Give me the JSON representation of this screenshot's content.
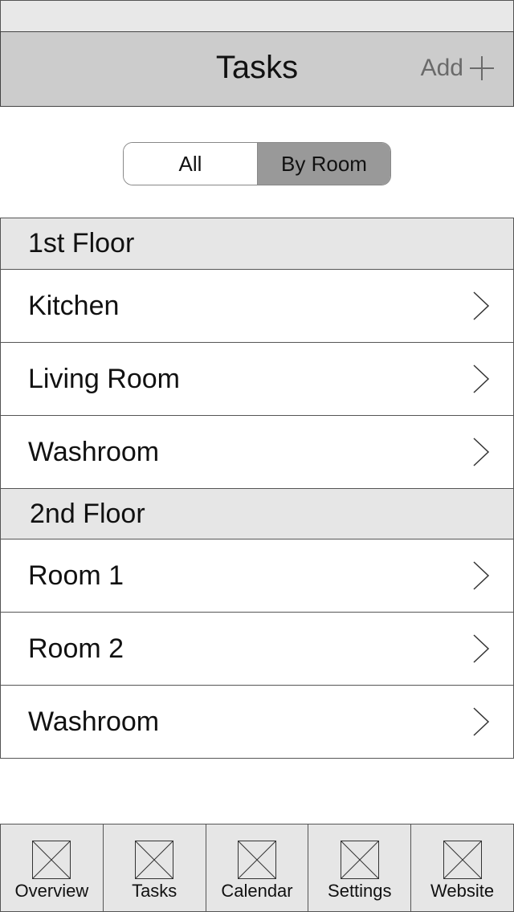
{
  "header": {
    "title": "Tasks",
    "add_label": "Add"
  },
  "segmented": {
    "options": [
      "All",
      "By Room"
    ],
    "selected": "By Room"
  },
  "sections": [
    {
      "title": "1st Floor",
      "rows": [
        "Kitchen",
        "Living Room",
        "Washroom"
      ]
    },
    {
      "title": "2nd Floor",
      "rows": [
        "Room 1",
        "Room 2",
        "Washroom"
      ]
    }
  ],
  "tab_bar": {
    "tabs": [
      {
        "label": "Overview",
        "icon": "placeholder-image-icon"
      },
      {
        "label": "Tasks",
        "icon": "placeholder-image-icon"
      },
      {
        "label": "Calendar",
        "icon": "placeholder-image-icon"
      },
      {
        "label": "Settings",
        "icon": "placeholder-image-icon"
      },
      {
        "label": "Website",
        "icon": "placeholder-image-icon"
      }
    ]
  }
}
